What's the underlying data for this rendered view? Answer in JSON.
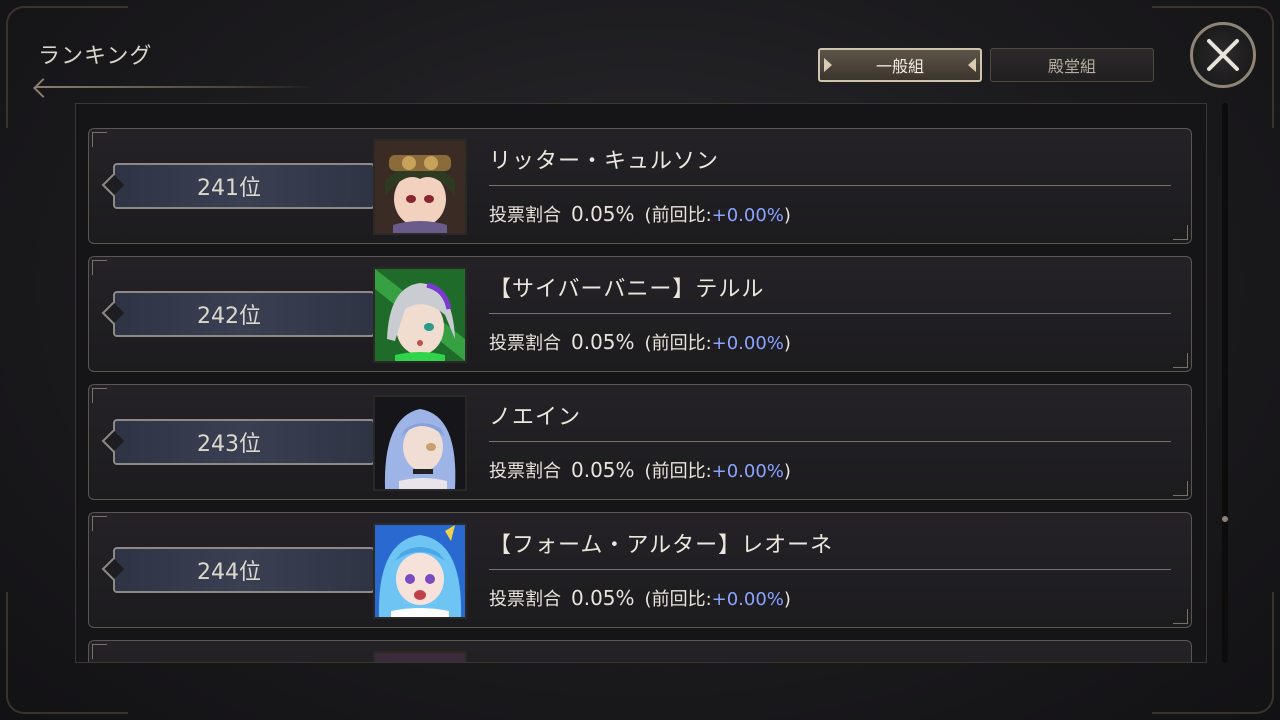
{
  "header": {
    "title": "ランキング"
  },
  "tabs": [
    {
      "label": "一般組",
      "active": true
    },
    {
      "label": "殿堂組",
      "active": false
    }
  ],
  "close_label": "close",
  "stat_label": "投票割合",
  "compare_label": "(前回比:",
  "compare_close": ")",
  "rows": [
    {
      "rank": "241位",
      "name": "リッター・キュルソン",
      "percent": "0.05%",
      "delta": "+0.00%",
      "portrait": "dark-haired-goggles-character"
    },
    {
      "rank": "242位",
      "name": "【サイバーバニー】テルル",
      "percent": "0.05%",
      "delta": "+0.00%",
      "portrait": "silver-haired-green-character"
    },
    {
      "rank": "243位",
      "name": "ノエイン",
      "percent": "0.05%",
      "delta": "+0.00%",
      "portrait": "blue-haired-character"
    },
    {
      "rank": "244位",
      "name": "【フォーム・アルター】レオーネ",
      "percent": "0.05%",
      "delta": "+0.00%",
      "portrait": "light-blue-haired-character"
    }
  ],
  "colors": {
    "accent_delta": "#8aa4ff",
    "plate": "#363b4c"
  }
}
